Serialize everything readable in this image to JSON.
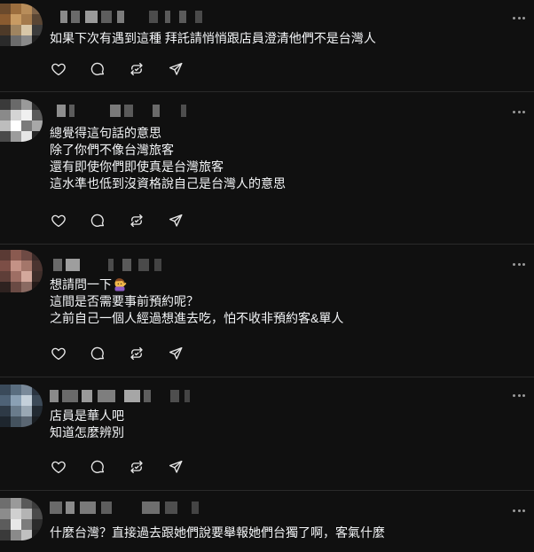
{
  "posts": [
    {
      "body_lines": [
        "如果下次有遇到這種 拜託請悄悄跟店員澄清他們不是台灣人"
      ]
    },
    {
      "body_lines": [
        "總覺得這句話的意思",
        "除了你們不像台灣旅客",
        "還有即使你們即使真是台灣旅客",
        "這水準也低到沒資格說自己是台灣人的意思"
      ]
    },
    {
      "body_lines": [
        "想請問一下",
        "這間是否需要事前預約呢？",
        "之前自己一個人經過想進去吃，怕不收非預約客&單人"
      ],
      "emoji_icon": "person-gesturing-emoji"
    },
    {
      "body_lines": [
        "店員是華人吧",
        "知道怎麼辨別"
      ]
    },
    {
      "body_lines": [
        "什麼台灣？直接過去跟她們說要舉報她們台獨了啊，客氣什麼"
      ]
    }
  ],
  "icons": {
    "like": "heart-icon",
    "reply": "comment-icon",
    "repost": "repost-icon",
    "share": "send-icon",
    "more": "more-icon"
  },
  "colors": {
    "background": "#101010",
    "text": "#f3f5f7",
    "divider": "#2a2a2a",
    "icon": "#e8e8e8"
  }
}
